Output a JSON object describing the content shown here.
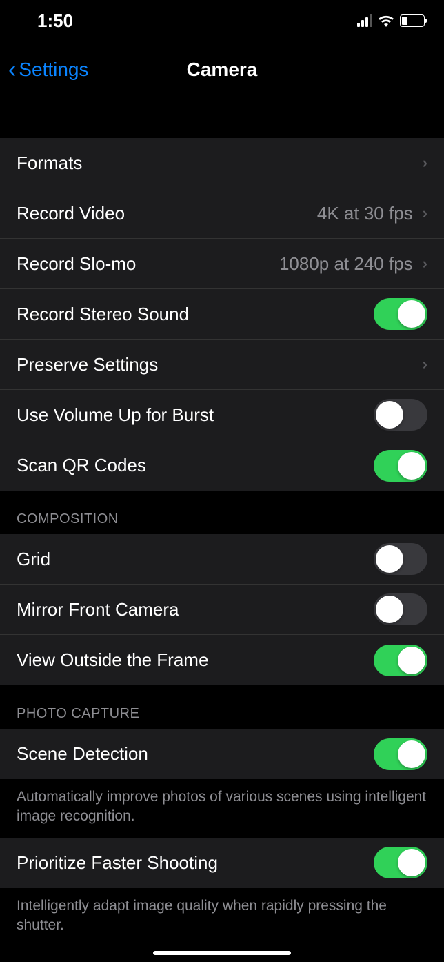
{
  "status": {
    "time": "1:50"
  },
  "nav": {
    "back": "Settings",
    "title": "Camera"
  },
  "rows": {
    "formats": "Formats",
    "record_video": {
      "label": "Record Video",
      "detail": "4K at 30 fps"
    },
    "record_slomo": {
      "label": "Record Slo-mo",
      "detail": "1080p at 240 fps"
    },
    "stereo_sound": {
      "label": "Record Stereo Sound",
      "on": true
    },
    "preserve": "Preserve Settings",
    "volume_burst": {
      "label": "Use Volume Up for Burst",
      "on": false
    },
    "scan_qr": {
      "label": "Scan QR Codes",
      "on": true
    }
  },
  "composition": {
    "header": "COMPOSITION",
    "grid": {
      "label": "Grid",
      "on": false
    },
    "mirror": {
      "label": "Mirror Front Camera",
      "on": false
    },
    "outside_frame": {
      "label": "View Outside the Frame",
      "on": true
    }
  },
  "photo_capture": {
    "header": "PHOTO CAPTURE",
    "scene_detection": {
      "label": "Scene Detection",
      "on": true
    },
    "scene_footer": "Automatically improve photos of various scenes using intelligent image recognition.",
    "faster_shooting": {
      "label": "Prioritize Faster Shooting",
      "on": true
    },
    "faster_footer": "Intelligently adapt image quality when rapidly pressing the shutter."
  }
}
